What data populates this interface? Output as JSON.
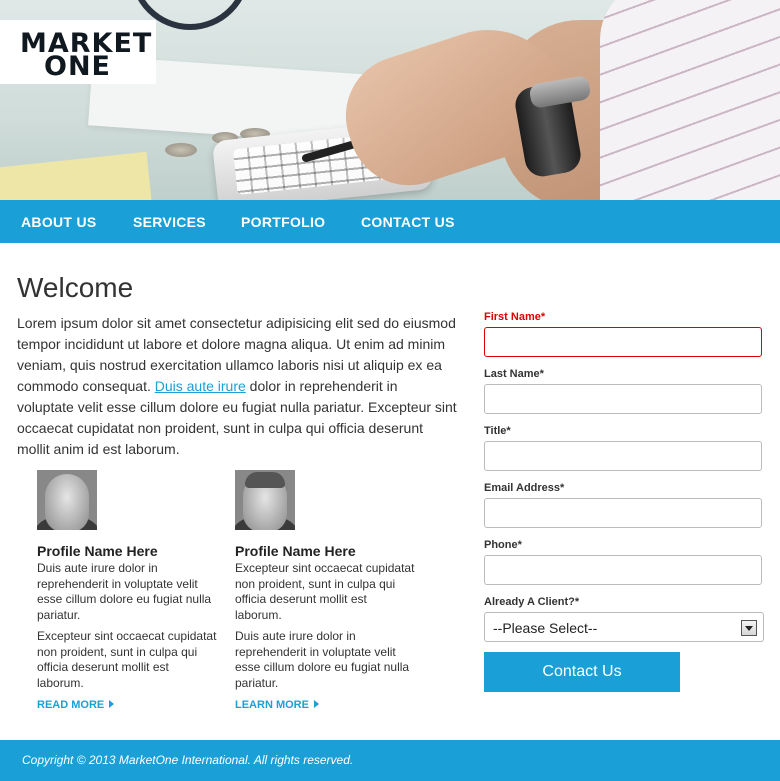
{
  "logo": {
    "line1": "MARKET",
    "line2": "ONE"
  },
  "nav": [
    {
      "label": "ABOUT US"
    },
    {
      "label": "SERVICES"
    },
    {
      "label": "PORTFOLIO"
    },
    {
      "label": "CONTACT US"
    }
  ],
  "welcome": {
    "title": "Welcome",
    "text_before": "Lorem ipsum dolor sit amet consectetur adipisicing elit sed do eiusmod tempor incididunt ut labore et dolore magna aliqua. Ut enim ad minim veniam, quis nostrud exercitation ullamco laboris nisi ut aliquip ex ea commodo consequat. ",
    "link": "Duis aute irure",
    "text_after": " dolor in reprehenderit in voluptate velit esse cillum dolore eu fugiat nulla pariatur. Excepteur sint occaecat cupidatat non proident, sunt in culpa qui officia deserunt mollit anim id est laborum."
  },
  "profiles": [
    {
      "name": "Profile Name Here",
      "p1": "Duis aute irure dolor in reprehenderit in voluptate velit esse cillum dolore eu fugiat nulla pariatur.",
      "p2": "Excepteur sint occaecat cupidatat non proident, sunt in culpa qui officia deserunt mollit est laborum.",
      "link": "READ MORE"
    },
    {
      "name": "Profile Name Here",
      "p1": "Excepteur sint occaecat cupidatat non proident, sunt in culpa qui officia deserunt mollit est laborum.",
      "p2": "Duis aute irure dolor in reprehenderit in voluptate velit esse cillum dolore eu fugiat nulla pariatur.",
      "link": "LEARN MORE"
    }
  ],
  "form": {
    "first_name": {
      "label": "First Name*",
      "value": ""
    },
    "last_name": {
      "label": "Last Name*",
      "value": ""
    },
    "title": {
      "label": "Title*",
      "value": ""
    },
    "email": {
      "label": "Email Address*",
      "value": ""
    },
    "phone": {
      "label": "Phone*",
      "value": ""
    },
    "client": {
      "label": "Already A Client?*",
      "selected": "--Please Select--"
    },
    "submit": "Contact Us"
  },
  "footer": {
    "copyright": "Copyright © 2013 MarketOne International. All rights reserved."
  },
  "colors": {
    "accent": "#1aa0d6",
    "error": "#dd0000"
  }
}
